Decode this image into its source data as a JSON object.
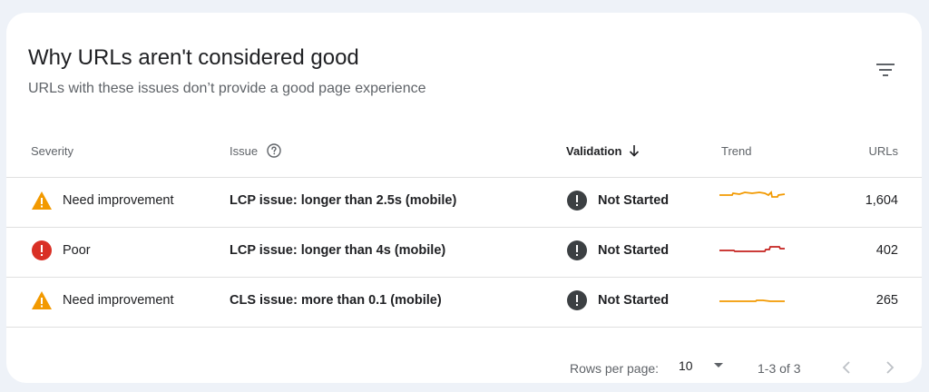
{
  "card": {
    "title": "Why URLs aren't considered good",
    "subtitle": "URLs with these issues don’t provide a good page experience",
    "filter_icon": "filter-list-icon"
  },
  "columns": {
    "severity": "Severity",
    "issue": "Issue",
    "validation": "Validation",
    "trend": "Trend",
    "urls": "URLs"
  },
  "rows": [
    {
      "severity": "Need improvement",
      "severity_icon": "warning-triangle-icon",
      "issue": "LCP issue: longer than 2.5s (mobile)",
      "validation": "Not Started",
      "urls": "1,604",
      "trend_color": "#f29900"
    },
    {
      "severity": "Poor",
      "severity_icon": "error-circle-icon",
      "issue": "LCP issue: longer than 4s (mobile)",
      "validation": "Not Started",
      "urls": "402",
      "trend_color": "#c5221f"
    },
    {
      "severity": "Need improvement",
      "severity_icon": "warning-triangle-icon",
      "issue": "CLS issue: more than 0.1 (mobile)",
      "validation": "Not Started",
      "urls": "265",
      "trend_color": "#f29900"
    }
  ],
  "pagination": {
    "rows_per_page_label": "Rows per page:",
    "rows_per_page_value": "10",
    "range": "1-3 of 3"
  },
  "colors": {
    "warning": "#f29900",
    "error": "#d93025",
    "status_dark": "#3c4043"
  }
}
